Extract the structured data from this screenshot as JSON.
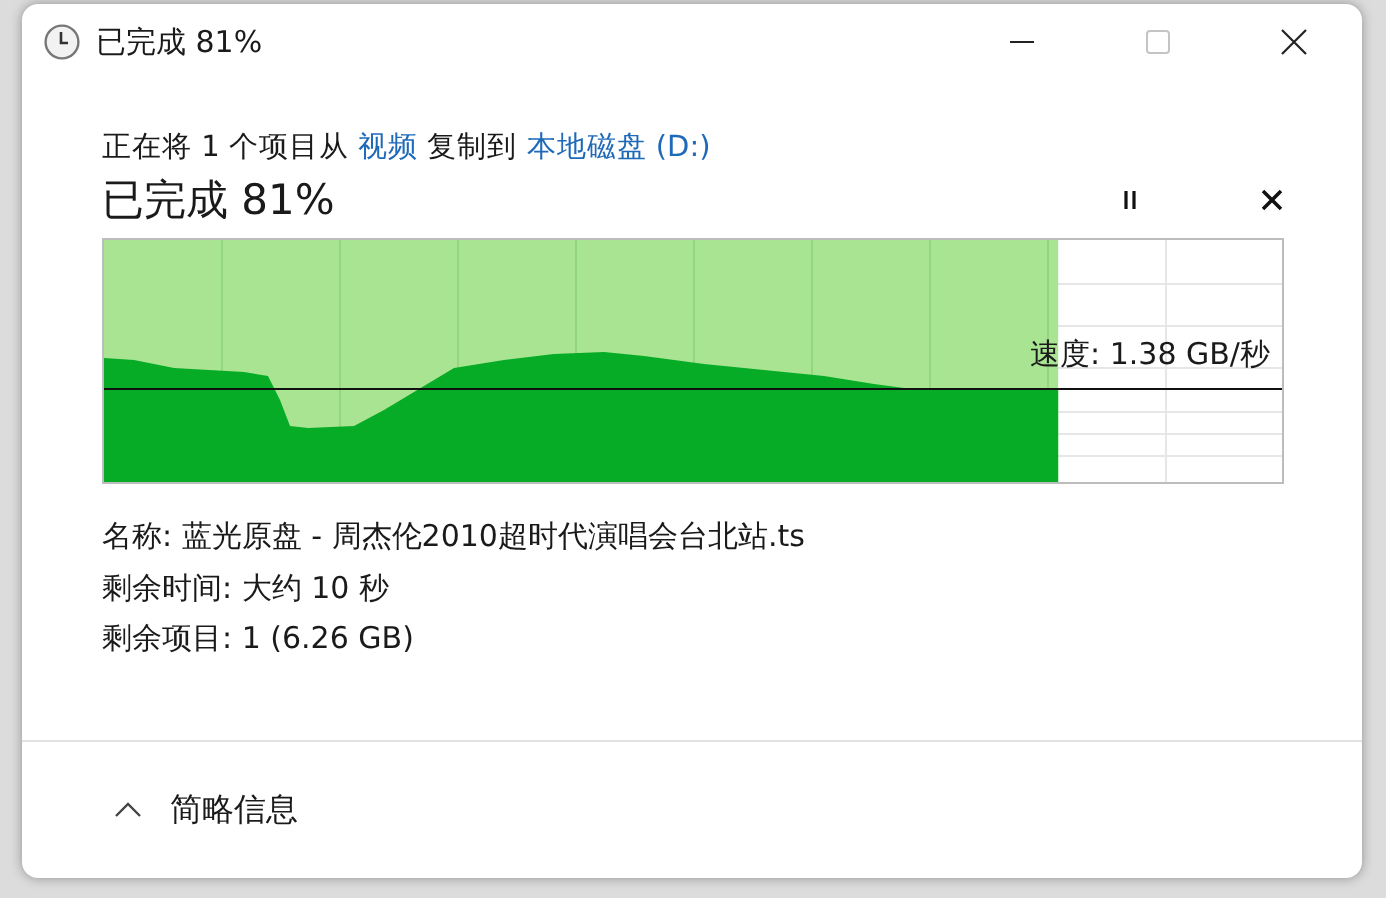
{
  "window": {
    "title": "已完成 81%",
    "buttons": [
      {
        "kind": "minimize",
        "disabled": false
      },
      {
        "kind": "maximize",
        "disabled": true
      },
      {
        "kind": "close",
        "disabled": false
      }
    ]
  },
  "description": [
    {
      "kind": "text",
      "text": "正在将 1 个项目从 "
    },
    {
      "kind": "link",
      "text": "视频"
    },
    {
      "kind": "text",
      "text": " 复制到 "
    },
    {
      "kind": "link",
      "text": "本地磁盘 (D:)"
    }
  ],
  "heading": "已完成 81%",
  "progress": {
    "level": 0.81,
    "speed": "速度: 1.38 GB/秒"
  },
  "details": [
    "名称: 蓝光原盘 - 周杰伦2010超时代演唱会台北站.ts",
    "剩余时间: 大约 10 秒",
    "剩余项目: 1 (6.26 GB)"
  ],
  "footer": {
    "label": "简略信息"
  }
}
